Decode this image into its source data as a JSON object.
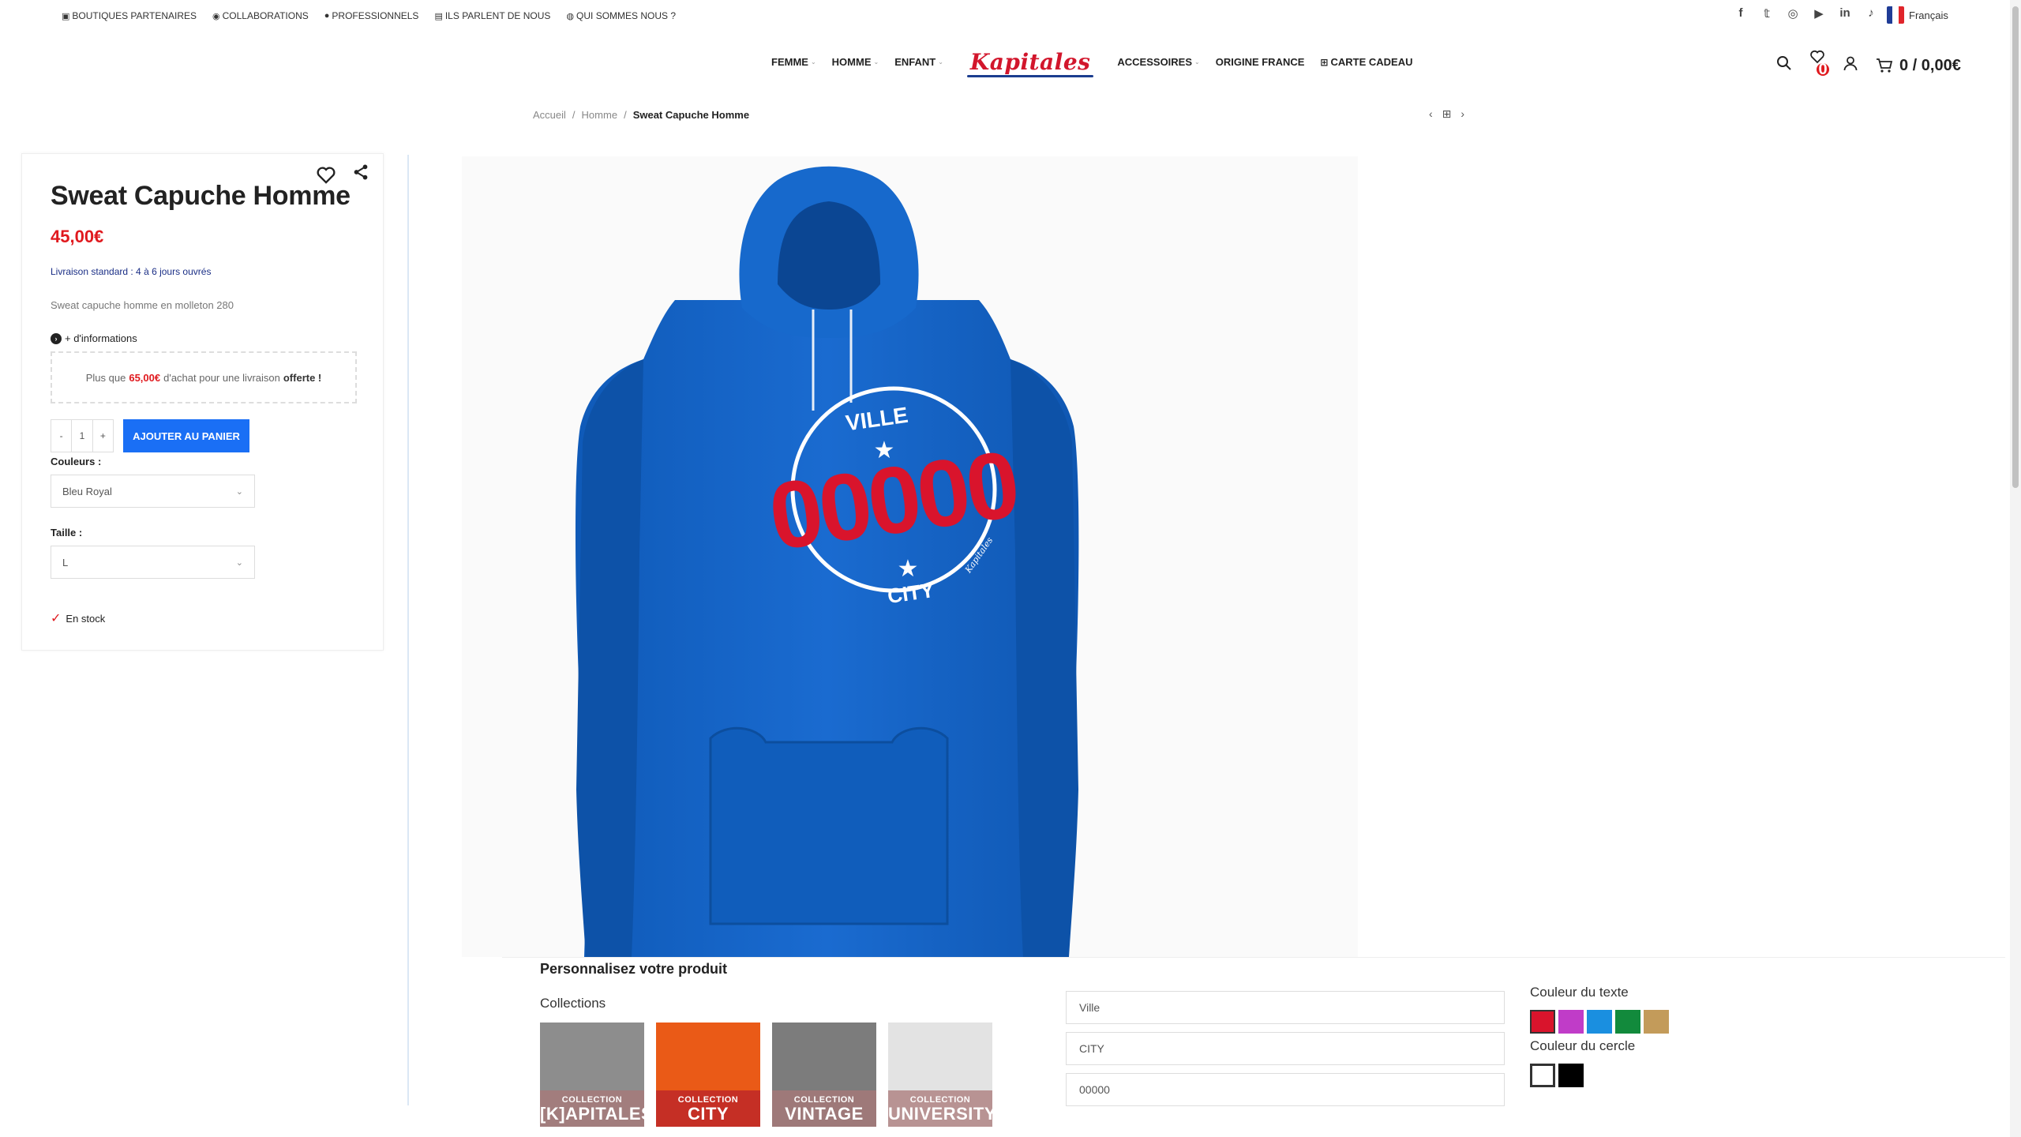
{
  "topbar": {
    "links": [
      {
        "icon": "store-icon",
        "glyph": "▣",
        "label": "BOUTIQUES PARTENAIRES"
      },
      {
        "icon": "handshake-icon",
        "glyph": "◉",
        "label": "COLLABORATIONS"
      },
      {
        "icon": "user-icon",
        "glyph": "●",
        "label": "PROFESSIONNELS"
      },
      {
        "icon": "newspaper-icon",
        "glyph": "▤",
        "label": "ILS PARLENT DE NOUS"
      },
      {
        "icon": "people-icon",
        "glyph": "◍",
        "label": "QUI SOMMES NOUS ?"
      }
    ],
    "social": [
      "facebook-icon",
      "twitter-icon",
      "instagram-icon",
      "youtube-icon",
      "linkedin-icon",
      "tiktok-icon"
    ],
    "social_glyphs": [
      "f",
      "𝕥",
      "◎",
      "▶",
      "in",
      "♪"
    ],
    "language": "Français"
  },
  "nav": {
    "items_left": [
      "FEMME",
      "HOMME",
      "ENFANT"
    ],
    "logo": "Kapitales",
    "items_right": [
      "ACCESSOIRES",
      "ORIGINE FRANCE",
      "CARTE CADEAU"
    ],
    "wishlist_count": "0",
    "cart_total": "0 / 0,00€"
  },
  "breadcrumb": {
    "home": "Accueil",
    "category": "Homme",
    "current": "Sweat Capuche Homme"
  },
  "product": {
    "title": "Sweat Capuche Homme",
    "price": "45,00€",
    "delivery": "Livraison standard : 4 à 6 jours ouvrés",
    "description": "Sweat capuche homme en molleton 280",
    "more_info": "+ d'informations",
    "free_shipping": {
      "prefix": "Plus que",
      "amount": "65,00€",
      "middle": "d'achat pour une livraison",
      "suffix": "offerte !"
    },
    "quantity": "1",
    "add_to_cart": "AJOUTER AU PANIER",
    "color_label": "Couleurs",
    "color_value": "Bleu Royal",
    "size_label": "Taille",
    "size_value": "L",
    "stock": "En stock"
  },
  "design": {
    "top_text": "VILLE",
    "number": "00000",
    "bottom_text": "CITY",
    "signature": "Kapitales",
    "hoodie_color": "#1565c6",
    "number_color": "#d9142c"
  },
  "customizer": {
    "title": "Personnalisez votre produit",
    "collections_label": "Collections",
    "collections": [
      {
        "small": "COLLECTION",
        "big": "[K]APITALES",
        "bg": "#8d8d8d",
        "tint": "rgba(170,120,120,0.75)"
      },
      {
        "small": "COLLECTION",
        "big": "CITY",
        "bg": "#ea5a17",
        "tint": "rgba(190,40,40,0.85)"
      },
      {
        "small": "COLLECTION",
        "big": "VINTAGE",
        "bg": "#7c7c7c",
        "tint": "rgba(170,120,120,0.75)"
      },
      {
        "small": "COLLECTION",
        "big": "UNIVERSITY",
        "bg": "#e3e3e3",
        "tint": "rgba(170,120,120,0.75)"
      }
    ],
    "field1": "Ville",
    "field2": "CITY",
    "field3": "00000",
    "text_color_label": "Couleur du texte",
    "text_colors": [
      "#d9142c",
      "#c03cc8",
      "#1a8fe0",
      "#128a3c",
      "#c39b5a"
    ],
    "circle_color_label": "Couleur du cercle",
    "circle_colors": [
      "#ffffff",
      "#000000"
    ]
  }
}
